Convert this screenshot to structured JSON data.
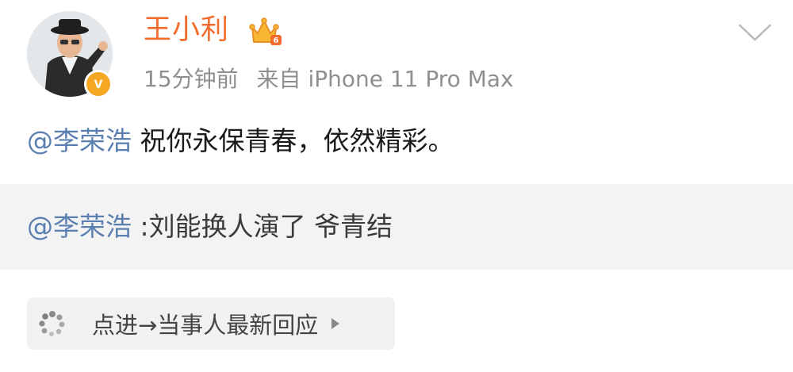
{
  "post": {
    "author": {
      "name": "王小利",
      "avatar_icon": "user-avatar-photo",
      "verified_icon": "verified-badge-icon",
      "member_badge_icon": "crown-badge-icon"
    },
    "time": "15分钟前",
    "source": "来自 iPhone 11 Pro Max",
    "text": {
      "mention": "@李荣浩",
      "body": " 祝你永保青春，依然精彩。"
    },
    "repost": {
      "mention": "@李荣浩",
      "body": " :刘能换人演了 爷青结"
    },
    "response_chip": {
      "icon": "loading-spinner-icon",
      "label": "点进→当事人最新回应",
      "arrow_icon": "play-arrow-icon"
    },
    "menu_icon": "chevron-down-icon"
  },
  "colors": {
    "username": "#f26b2b",
    "mention": "#5b7fb0",
    "meta": "#8f8f8f",
    "verified": "#f5a623",
    "repost_bg": "#f3f3f3"
  }
}
